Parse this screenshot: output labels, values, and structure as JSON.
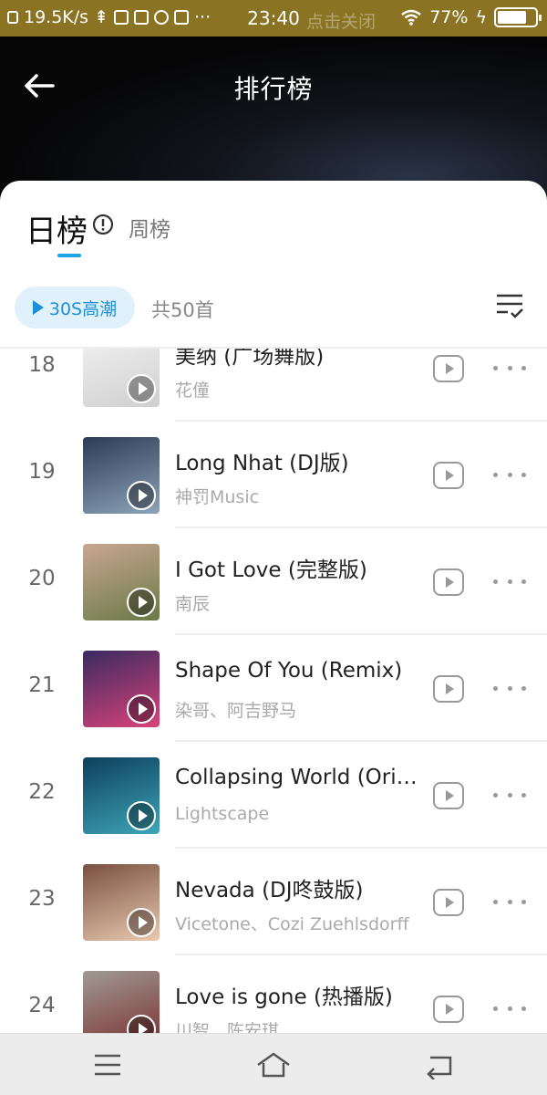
{
  "status_bar": {
    "network_speed": "19.5K/s",
    "time": "23:40",
    "notification_text": "点击关闭",
    "battery": "77%",
    "icons": [
      "data-icon",
      "usb-icon",
      "app-icon",
      "app-icon",
      "app-icon",
      "app-icon",
      "more-icon",
      "wifi-icon",
      "battery-icon",
      "charging-icon"
    ]
  },
  "header": {
    "title": "排行榜",
    "back_icon": "back-arrow-icon"
  },
  "tabs": {
    "daily": "日榜",
    "weekly": "周榜",
    "info_icon": "info-icon"
  },
  "controls": {
    "play_label": "30S高潮",
    "count": "共50首",
    "sort_icon": "list-check-icon"
  },
  "songs": [
    {
      "rank": "18",
      "title": "美纳 (广场舞版)",
      "artist": "花僮",
      "cover_colors": [
        "#f3f3f3",
        "#cfcfcf"
      ]
    },
    {
      "rank": "19",
      "title": "Long Nhat (DJ版)",
      "artist": "神罚Music",
      "cover_colors": [
        "#2c3b55",
        "#8da3b8"
      ]
    },
    {
      "rank": "20",
      "title": "I Got Love (完整版)",
      "artist": "南辰",
      "cover_colors": [
        "#c9a691",
        "#6a7a48"
      ]
    },
    {
      "rank": "21",
      "title": "Shape Of You (Remix)",
      "artist": "染哥、阿吉野马",
      "cover_colors": [
        "#3a2a60",
        "#d8437a"
      ]
    },
    {
      "rank": "22",
      "title": "Collapsing World (Original Mix)",
      "artist": "Lightscape",
      "cover_colors": [
        "#0d3f5c",
        "#3ea5b8"
      ]
    },
    {
      "rank": "23",
      "title": "Nevada (DJ咚鼓版)",
      "artist": "Vicetone、Cozi Zuehlsdorff",
      "cover_colors": [
        "#7a5040",
        "#e9c9b0"
      ]
    },
    {
      "rank": "24",
      "title": "Love is gone (热播版)",
      "artist": "川智、陈安琪",
      "cover_colors": [
        "#a09a94",
        "#7a3030"
      ]
    }
  ],
  "navbar": {
    "menu_icon": "menu-icon",
    "home_icon": "home-icon",
    "back_icon": "return-icon"
  }
}
